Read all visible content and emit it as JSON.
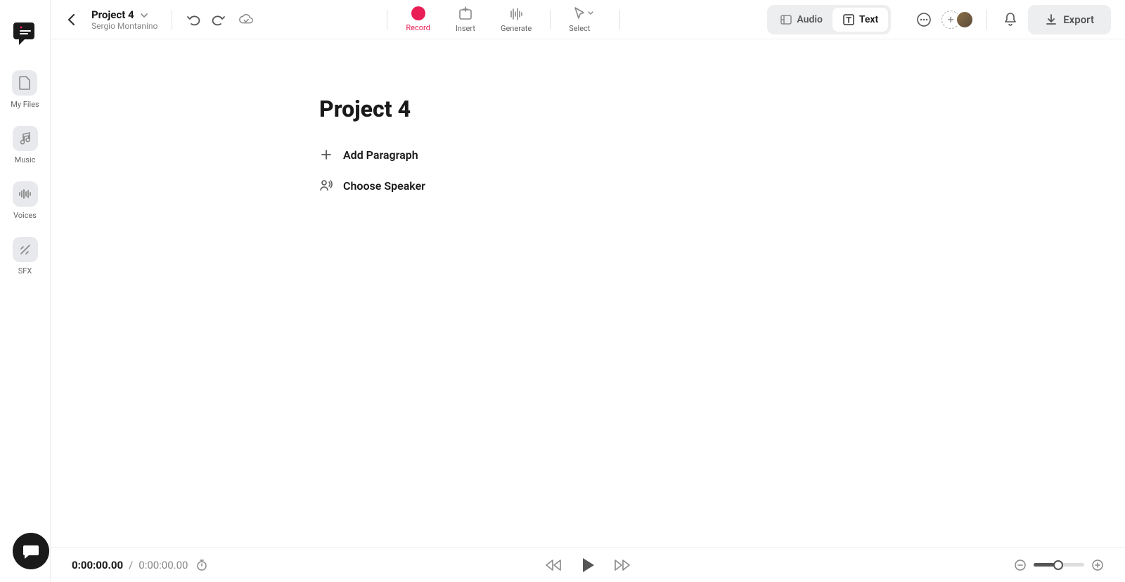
{
  "header": {
    "project_title": "Project 4",
    "owner": "Sergio Montanino"
  },
  "tools": {
    "record": "Record",
    "insert": "Insert",
    "generate": "Generate",
    "select": "Select"
  },
  "mode": {
    "audio": "Audio",
    "text": "Text"
  },
  "export_label": "Export",
  "sidebar": {
    "items": [
      {
        "label": "My Files"
      },
      {
        "label": "Music"
      },
      {
        "label": "Voices"
      },
      {
        "label": "SFX"
      }
    ]
  },
  "document": {
    "title": "Project 4",
    "actions": {
      "add_paragraph": "Add Paragraph",
      "choose_speaker": "Choose Speaker"
    }
  },
  "player": {
    "current": "0:00:00.00",
    "sep": "/",
    "duration": "0:00:00.00"
  }
}
